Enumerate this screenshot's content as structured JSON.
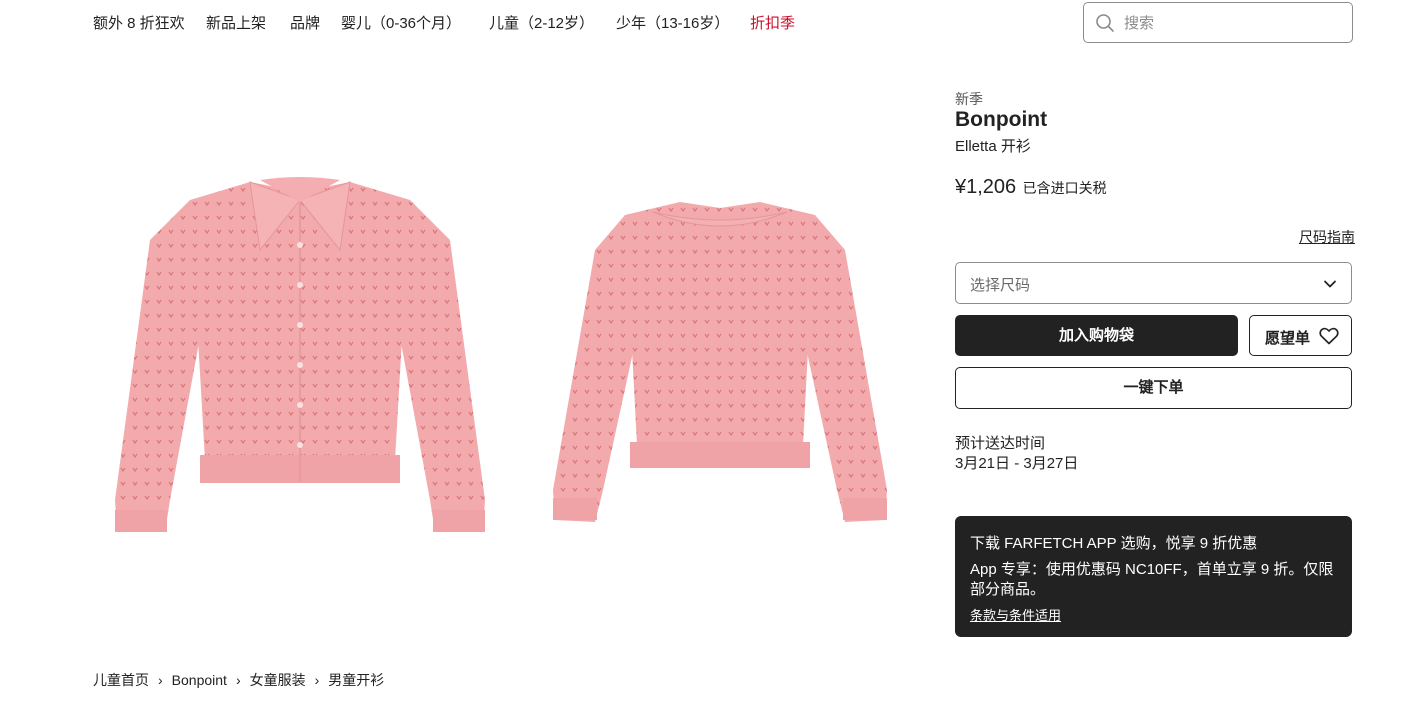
{
  "nav": {
    "items": [
      {
        "label": "额外 8 折狂欢"
      },
      {
        "label": "新品上架"
      },
      {
        "label": "品牌"
      },
      {
        "label": "婴儿（0-36个月）"
      },
      {
        "label": "儿童（2-12岁）"
      },
      {
        "label": "少年（13-16岁）"
      },
      {
        "label": "折扣季"
      }
    ],
    "sale_color": "#c8102e"
  },
  "search": {
    "placeholder": "搜索",
    "icon": "search-icon"
  },
  "product": {
    "season_label": "新季",
    "brand": "Bonpoint",
    "name": "Elletta 开衫",
    "price": "¥1,206",
    "price_note": "已含进口关税",
    "image_color": "#f2a8ab"
  },
  "size": {
    "guide_label": "尺码指南",
    "select_placeholder": "选择尺码",
    "icon": "chevron-down-icon"
  },
  "actions": {
    "add_to_bag": "加入购物袋",
    "wishlist": "愿望单",
    "wishlist_icon": "heart-icon",
    "one_click": "一键下单"
  },
  "delivery": {
    "title": "预计送达时间",
    "dates": "3月21日 - 3月27日"
  },
  "promo": {
    "title": "下载 FARFETCH APP 选购，悦享 9 折优惠",
    "body": "App 专享：使用优惠码 NC10FF，首单立享 9 折。仅限部分商品。",
    "link": "条款与条件适用"
  },
  "breadcrumb": {
    "items": [
      "儿童首页",
      "Bonpoint",
      "女童服装",
      "男童开衫"
    ],
    "separator": "›"
  }
}
